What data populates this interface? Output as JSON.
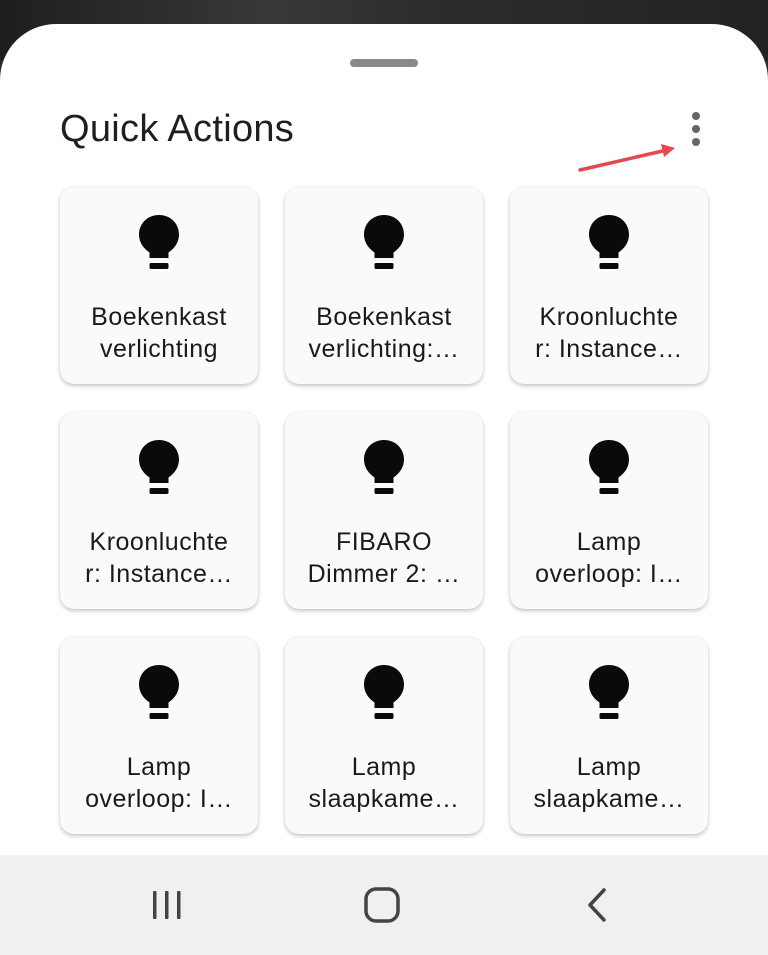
{
  "header": {
    "title": "Quick Actions"
  },
  "tiles": [
    {
      "line1": "Boekenkast",
      "line2": "verlichting",
      "icon": "lightbulb-icon"
    },
    {
      "line1": "Boekenkast",
      "line2": "verlichting:…",
      "icon": "lightbulb-icon"
    },
    {
      "line1": "Kroonluchte",
      "line2": "r: Instance…",
      "icon": "lightbulb-icon"
    },
    {
      "line1": "Kroonluchte",
      "line2": "r: Instance…",
      "icon": "lightbulb-icon"
    },
    {
      "line1": "FIBARO",
      "line2": "Dimmer 2: …",
      "icon": "lightbulb-icon"
    },
    {
      "line1": "Lamp",
      "line2": "overloop: I…",
      "icon": "lightbulb-icon"
    },
    {
      "line1": "Lamp",
      "line2": "overloop: I…",
      "icon": "lightbulb-icon"
    },
    {
      "line1": "Lamp",
      "line2": "slaapkame…",
      "icon": "lightbulb-icon"
    },
    {
      "line1": "Lamp",
      "line2": "slaapkame…",
      "icon": "lightbulb-icon"
    }
  ],
  "navbar": {
    "icons": [
      "recent-apps-icon",
      "home-icon",
      "back-icon"
    ]
  },
  "colors": {
    "annotation_arrow": "#e5484d",
    "tile_background": "#fafafa",
    "sheet_background": "#ffffff",
    "navbar_background": "#f0f0f0"
  }
}
